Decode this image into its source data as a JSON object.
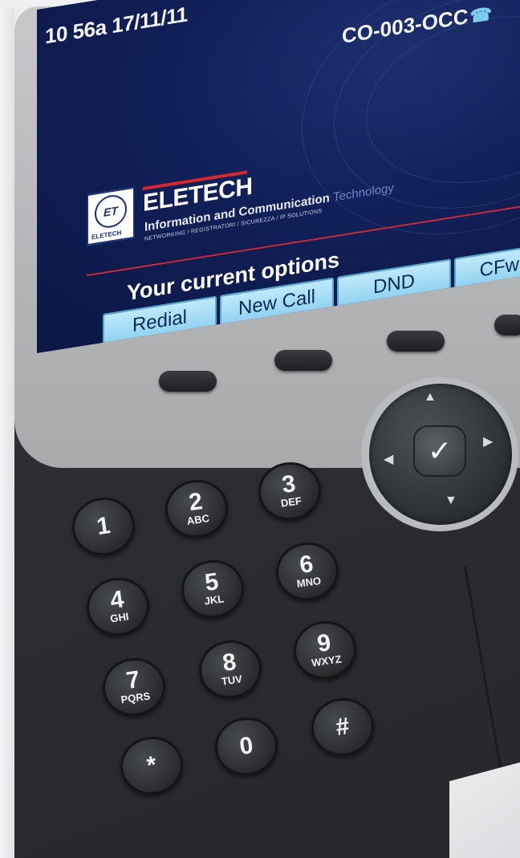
{
  "status_bar": {
    "time_date": "10 56a 17/11/11",
    "line_label": "CO-003-OCC"
  },
  "logo": {
    "emblem_text": "ELETECH",
    "name": "ELETECH",
    "tagline_main": "Information and Communication",
    "tagline_accent": "Technology",
    "subline": "NETWORKING / REGISTRATORI / SICUREZZA / IP SOLUTIONS"
  },
  "options_title": "Your current options",
  "softkeys": [
    "Redial",
    "New Call",
    "DND",
    "CFwdA"
  ],
  "keypad": [
    {
      "digit": "1",
      "letters": ""
    },
    {
      "digit": "2",
      "letters": "ABC"
    },
    {
      "digit": "3",
      "letters": "DEF"
    },
    {
      "digit": "4",
      "letters": "GHI"
    },
    {
      "digit": "5",
      "letters": "JKL"
    },
    {
      "digit": "6",
      "letters": "MNO"
    },
    {
      "digit": "7",
      "letters": "PQRS"
    },
    {
      "digit": "8",
      "letters": "TUV"
    },
    {
      "digit": "9",
      "letters": "WXYZ"
    },
    {
      "digit": "*",
      "letters": ""
    },
    {
      "digit": "0",
      "letters": ""
    },
    {
      "digit": "#",
      "letters": ""
    }
  ],
  "icons": {
    "line_status": "phone-icon",
    "nav_select": "checkmark-icon"
  },
  "colors": {
    "screen_bg": "#112058",
    "softkey_bg": "#a6ddf5",
    "brand_red": "#d7262c"
  }
}
